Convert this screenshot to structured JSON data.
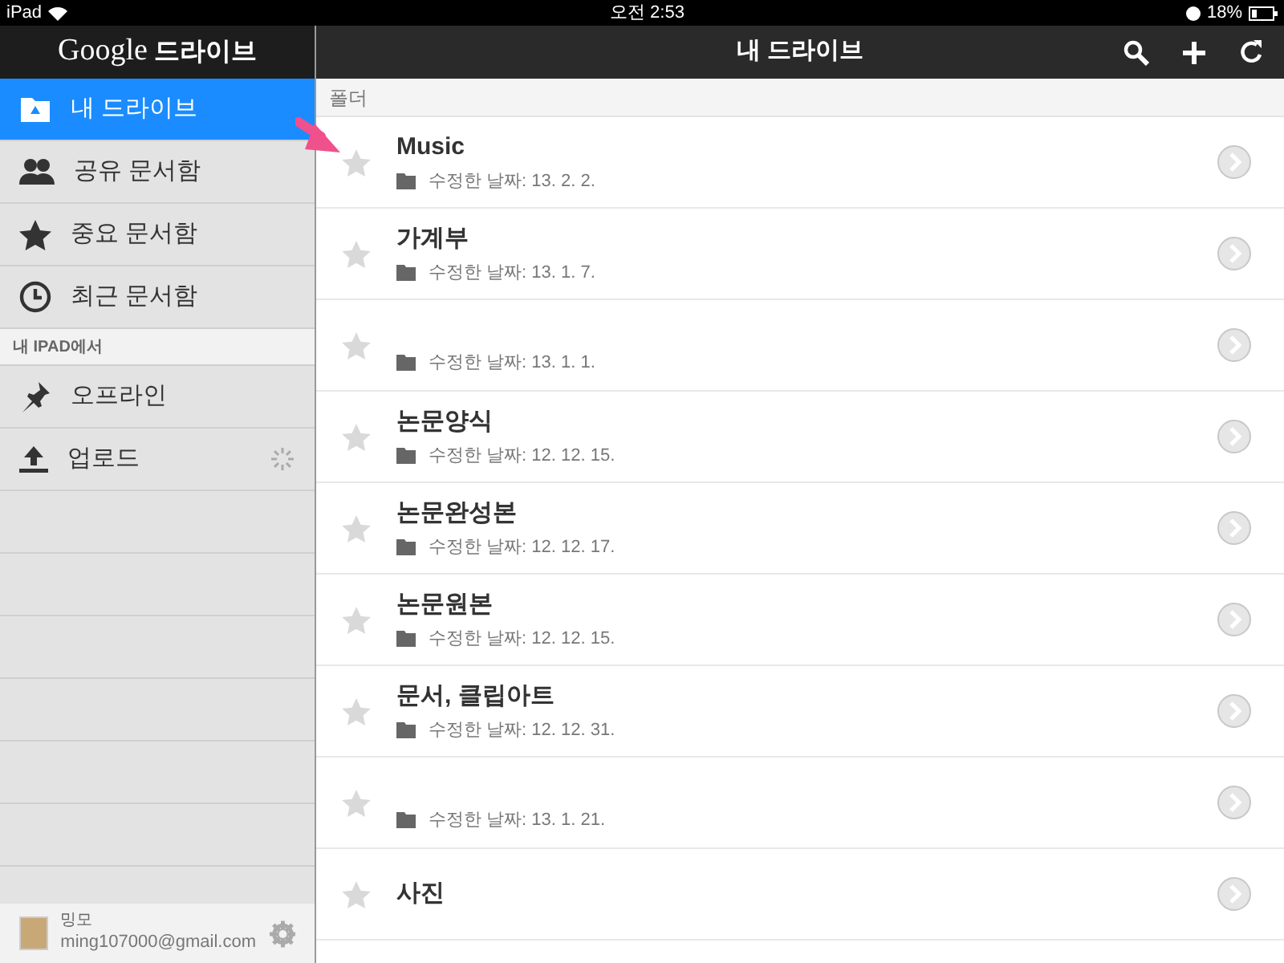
{
  "status_bar": {
    "device": "iPad",
    "time": "오전 2:53",
    "battery": "18%"
  },
  "sidebar": {
    "logo_google": "Google",
    "logo_product": "드라이브",
    "items": [
      {
        "label": "내 드라이브",
        "kind": "drive",
        "selected": true
      },
      {
        "label": "공유 문서함",
        "kind": "shared",
        "selected": false
      },
      {
        "label": "중요 문서함",
        "kind": "starred",
        "selected": false
      },
      {
        "label": "최근 문서함",
        "kind": "recent",
        "selected": false
      }
    ],
    "section": "내 IPAD에서",
    "device_items": [
      {
        "label": "오프라인",
        "kind": "offline",
        "busy": false
      },
      {
        "label": "업로드",
        "kind": "upload",
        "busy": true
      }
    ],
    "account": {
      "name": "밍모",
      "email": "ming107000@gmail.com"
    }
  },
  "header": {
    "title": "내 드라이브"
  },
  "list": {
    "section": "폴더",
    "rows": [
      {
        "name": "Music",
        "meta": "수정한 날짜: 13. 2. 2.",
        "starred": false
      },
      {
        "name": "가계부",
        "meta": "수정한 날짜: 13. 1. 7.",
        "starred": false
      },
      {
        "meta": "수정한 날짜: 13. 1. 1.",
        "starred": false
      },
      {
        "name": "논문양식",
        "meta": "수정한 날짜: 12. 12. 15.",
        "starred": false
      },
      {
        "name": "논문완성본",
        "meta": "수정한 날짜: 12. 12. 17.",
        "starred": false
      },
      {
        "name": "논문원본",
        "meta": "수정한 날짜: 12. 12. 15.",
        "starred": false
      },
      {
        "name": "문서, 클립아트",
        "meta": "수정한 날짜: 12. 12. 31.",
        "starred": false
      },
      {
        "meta": "수정한 날짜: 13. 1. 21.",
        "starred": false
      },
      {
        "name": "사진",
        "starred": false
      }
    ]
  }
}
